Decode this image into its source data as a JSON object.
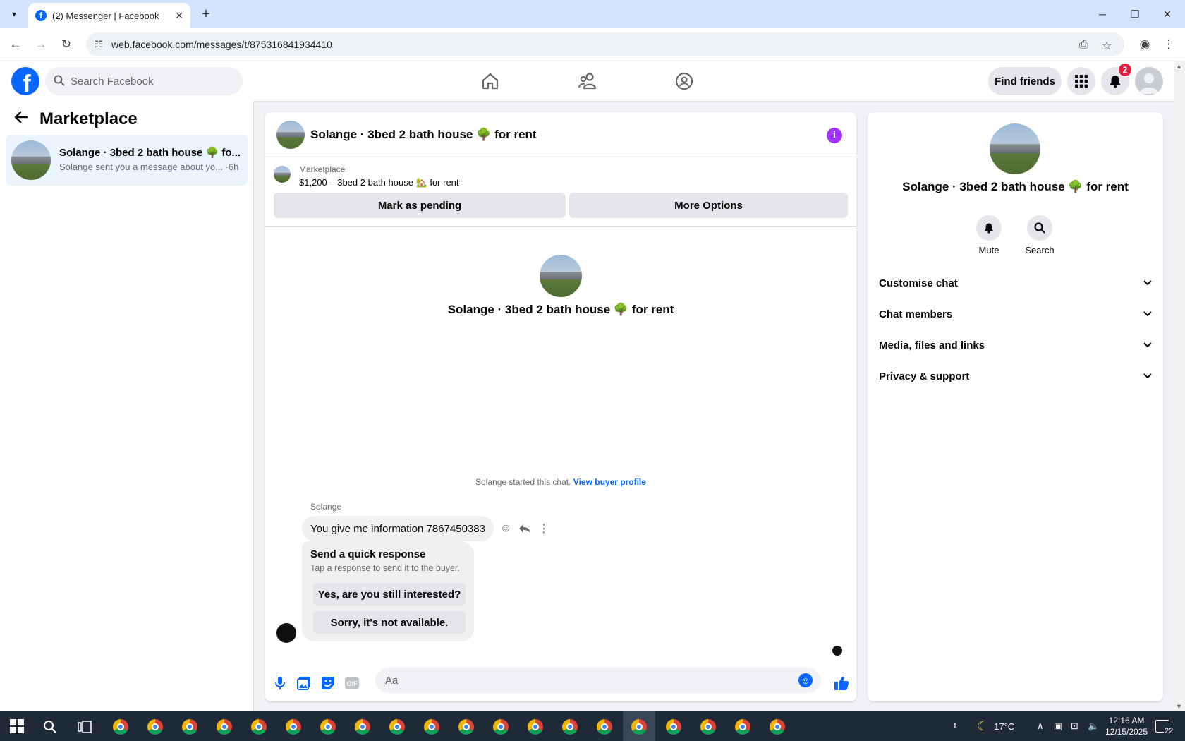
{
  "browser": {
    "tab_title": "(2) Messenger | Facebook",
    "url": "web.facebook.com/messages/t/875316841934410"
  },
  "fb_header": {
    "search_placeholder": "Search Facebook",
    "find_friends": "Find friends",
    "notification_count": "2",
    "brand_color": "#0866ff"
  },
  "left_panel": {
    "title": "Marketplace",
    "conversation": {
      "name": "Solange · 3bed 2 bath house 🌳 fo...",
      "preview": "Solange sent you a message about yo... ·6h"
    }
  },
  "chat": {
    "header_name": "Solange · 3bed 2 bath house 🌳 for rent",
    "marketplace_label": "Marketplace",
    "listing": "$1,200 – 3bed 2 bath house 🏡 for rent",
    "mark_pending": "Mark as pending",
    "more_options": "More Options",
    "center_name": "Solange · 3bed 2 bath house 🌳 for rent",
    "started_text": "Solange started this chat.",
    "view_buyer_profile": "View buyer profile",
    "sender": "Solange",
    "message": "You give me information 7867450383",
    "quick_title": "Send a quick response",
    "quick_subtitle": "Tap a response to send it to the buyer.",
    "quick_reply_1": "Yes, are you still interested?",
    "quick_reply_2": "Sorry, it's not available.",
    "composer_placeholder": "Aa"
  },
  "right_panel": {
    "name": "Solange · 3bed 2 bath house 🌳 for rent",
    "mute": "Mute",
    "search": "Search",
    "sections": [
      "Customise chat",
      "Chat members",
      "Media, files and links",
      "Privacy & support"
    ]
  },
  "taskbar": {
    "temperature": "17°C",
    "time": "12:16 AM",
    "date": "12/15/2025",
    "notifications": "22"
  }
}
